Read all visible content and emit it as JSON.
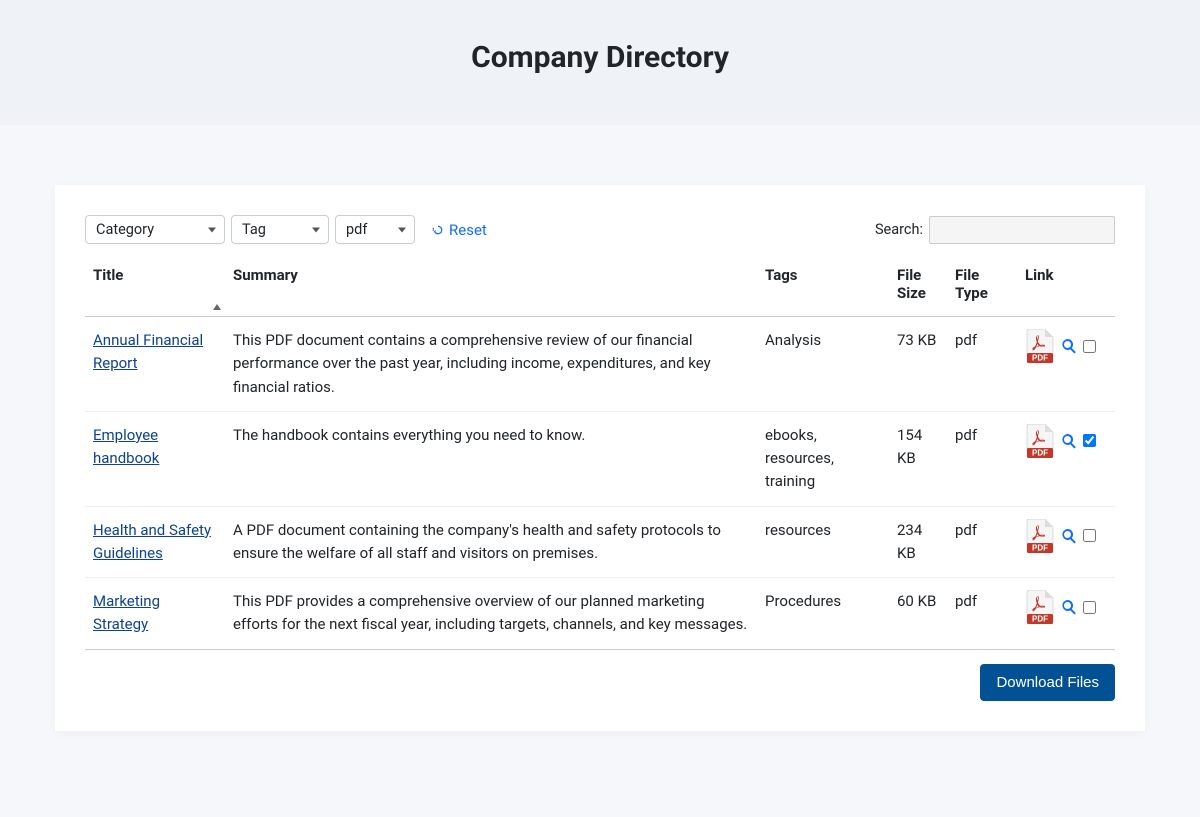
{
  "header": {
    "title": "Company Directory"
  },
  "filters": {
    "category_label": "Category",
    "tag_label": "Tag",
    "type_value": "pdf",
    "reset_label": "Reset"
  },
  "search": {
    "label": "Search:",
    "value": ""
  },
  "columns": {
    "title": "Title",
    "summary": "Summary",
    "tags": "Tags",
    "size": "File Size",
    "type": "File Type",
    "link": "Link"
  },
  "rows": [
    {
      "title": "Annual Financial Report",
      "summary": "This PDF document contains a comprehensive review of our financial performance over the past year, including income, expenditures, and key financial ratios.",
      "tags": "Analysis",
      "size": "73 KB",
      "type": "pdf",
      "checked": false
    },
    {
      "title": "Employee handbook",
      "summary": "The handbook contains everything you need to know.",
      "tags": "ebooks, resources, training",
      "size": "154 KB",
      "type": "pdf",
      "checked": true
    },
    {
      "title": "Health and Safety Guidelines",
      "summary": "A PDF document containing the company's health and safety protocols to ensure the welfare of all staff and visitors on premises.",
      "tags": "resources",
      "size": "234 KB",
      "type": "pdf",
      "checked": false
    },
    {
      "title": "Marketing Strategy",
      "summary": "This PDF provides a comprehensive overview of our planned marketing efforts for the next fiscal year, including targets, channels, and key messages.",
      "tags": "Procedures",
      "size": "60 KB",
      "type": "pdf",
      "checked": false
    }
  ],
  "actions": {
    "download_label": "Download Files"
  }
}
